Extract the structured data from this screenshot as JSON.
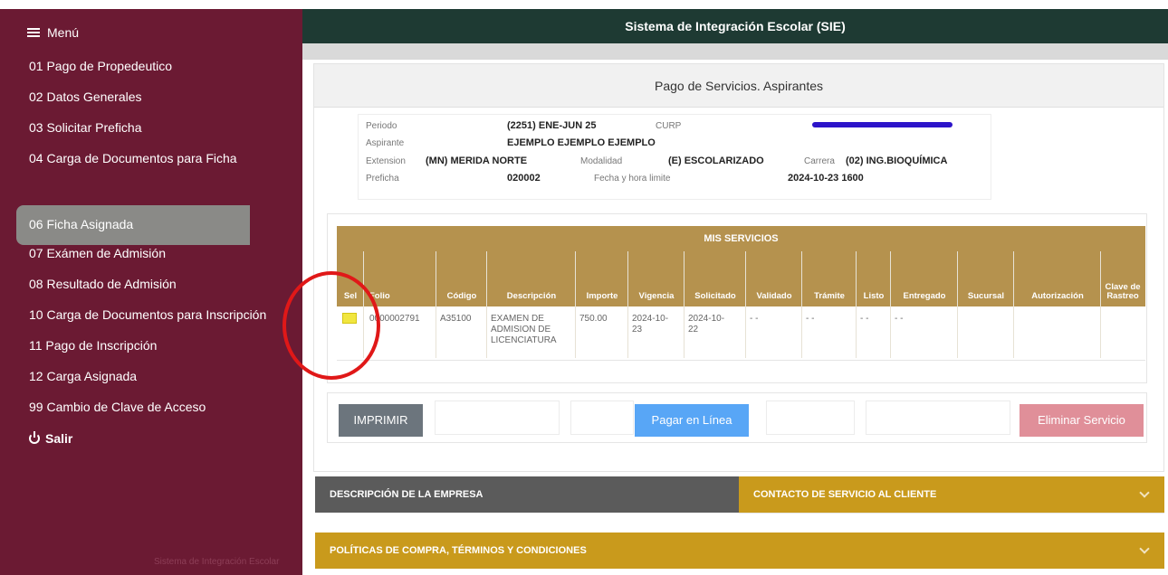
{
  "app": {
    "title": "Sistema de Integración Escolar (SIE)"
  },
  "sidebar": {
    "menu_label": "Menú",
    "items": [
      {
        "label": "01 Pago de Propedeutico"
      },
      {
        "label": "02 Datos Generales"
      },
      {
        "label": "03 Solicitar Preficha"
      },
      {
        "label": "04 Carga de Documentos para Ficha"
      },
      {
        "label": "06 Ficha Asignada",
        "active": true
      },
      {
        "label": "07 Exámen de Admisión"
      },
      {
        "label": "08 Resultado de Admisión"
      },
      {
        "label": "10 Carga de Documentos para Inscripción"
      },
      {
        "label": "11 Pago de Inscripción"
      },
      {
        "label": "12 Carga Asignada"
      },
      {
        "label": "99 Cambio de Clave de Acceso"
      }
    ],
    "logout_label": "Salir",
    "footer": "Sistema de Integración Escolar"
  },
  "page": {
    "title": "Pago de Servicios. Aspirantes"
  },
  "info": {
    "periodo_label": "Periodo",
    "periodo_value": "(2251) ENE-JUN 25",
    "curp_label": "CURP",
    "aspirante_label": "Aspirante",
    "aspirante_value": "EJEMPLO EJEMPLO EJEMPLO",
    "extension_label": "Extension",
    "extension_value": "(MN) MERIDA NORTE",
    "modalidad_label": "Modalidad",
    "modalidad_value": "(E) ESCOLARIZADO",
    "carrera_label": "Carrera",
    "carrera_value": "(02) ING.BIOQUÍMICA",
    "preficha_label": "Preficha",
    "preficha_value": "020002",
    "fecha_label": "Fecha y hora limite",
    "fecha_value": "2024-10-23 1600"
  },
  "services": {
    "title": "MIS SERVICIOS",
    "columns": [
      "Sel",
      "Folio",
      "Código",
      "Descripción",
      "Importe",
      "Vigencia",
      "Solicitado",
      "Validado",
      "Trámite",
      "Listo",
      "Entregado",
      "Sucursal",
      "Autorización",
      "Clave de Rastreo"
    ],
    "rows": [
      {
        "folio": "0000002791",
        "codigo": "A35100",
        "descripcion": "EXAMEN DE ADMISION DE LICENCIATURA",
        "importe": "750.00",
        "vigencia": "2024-10-23",
        "solicitado": "2024-10-22",
        "validado": "- -",
        "tramite": "- -",
        "listo": "- -",
        "entregado": "- -",
        "sucursal": "",
        "autorizacion": "",
        "clave_rastreo": ""
      }
    ]
  },
  "actions": {
    "print": "IMPRIMIR",
    "pay": "Pagar en Línea",
    "delete": "Eliminar Servicio"
  },
  "accordions": {
    "desc": "DESCRIPCIÓN DE LA EMPRESA",
    "contact": "CONTACTO DE SERVICIO AL CLIENTE",
    "policies": "POLÍTICAS DE COMPRA, TÉRMINOS Y CONDICIONES"
  },
  "colors": {
    "sidebar": "#6b1a33",
    "topbar": "#1e3a33",
    "table_header": "#b5924e",
    "accordion_gold": "#c99a1c",
    "annotation": "#e01818"
  }
}
